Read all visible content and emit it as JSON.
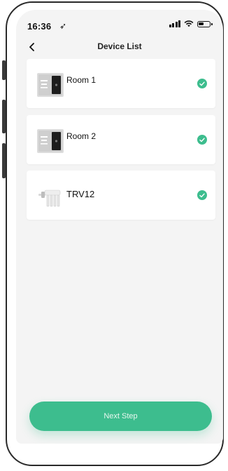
{
  "status_bar": {
    "time": "16:36",
    "location_glyph": "➶"
  },
  "nav": {
    "title": "Device List",
    "back_icon": "chevron-left-icon"
  },
  "devices": [
    {
      "name": "Room 1",
      "icon": "thermostat-panel-icon",
      "selected": true
    },
    {
      "name": "Room 2",
      "icon": "thermostat-panel-icon",
      "selected": true
    },
    {
      "name": "TRV12",
      "icon": "radiator-valve-icon",
      "selected": true
    }
  ],
  "footer": {
    "next_label": "Next Step"
  },
  "colors": {
    "accent": "#3dbd8e",
    "screen_bg": "#f4f4f4",
    "card_bg": "#ffffff"
  }
}
